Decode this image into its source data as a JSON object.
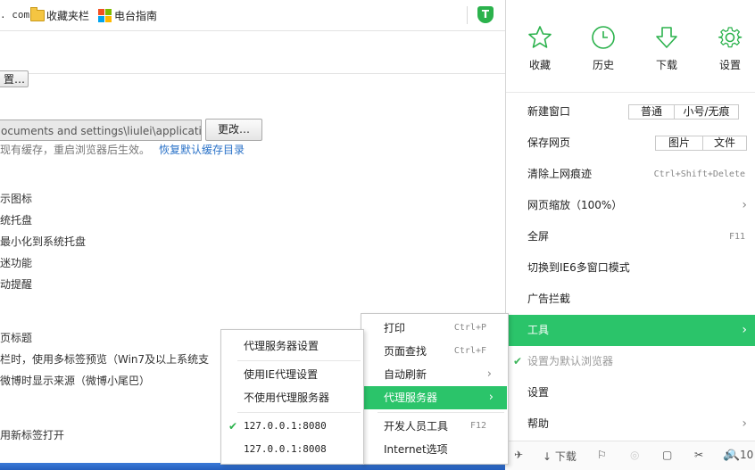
{
  "bookmarks": {
    "address_fragment": ". com",
    "folder_label": "收藏夹栏",
    "guide_label": "电台指南"
  },
  "settings": {
    "button_partial": "置…",
    "cache_path": "ocuments and settings\\liulei\\application",
    "change_button": "更改…",
    "hint_text": "现有缓存，重启浏览器后生效。",
    "restore_link": "恢复默认缓存目录",
    "options": [
      "示图标",
      "统托盘",
      "最小化到系统托盘",
      "迷功能",
      "动提醒",
      "页标题",
      "栏时，使用多标签预览（Win7及以上系统支",
      "微博时显示来源（微博小尾巴）",
      "用新标签打开"
    ]
  },
  "main_menu": {
    "quick": [
      {
        "label": "收藏",
        "icon": "star-icon"
      },
      {
        "label": "历史",
        "icon": "clock-icon"
      },
      {
        "label": "下载",
        "icon": "download-icon"
      },
      {
        "label": "设置",
        "icon": "gear-icon"
      }
    ],
    "new_window": {
      "label": "新建窗口",
      "opt1": "普通",
      "opt2": "小号/无痕"
    },
    "save_page": {
      "label": "保存网页",
      "opt1": "图片",
      "opt2": "文件"
    },
    "clear_traces": {
      "label": "清除上网痕迹",
      "shortcut": "Ctrl+Shift+Delete"
    },
    "zoom": {
      "label": "网页缩放（100%）"
    },
    "fullscreen": {
      "label": "全屏",
      "shortcut": "F11"
    },
    "ie6": {
      "label": "切换到IE6多窗口模式"
    },
    "adblock": {
      "label": "广告拦截"
    },
    "tools": {
      "label": "工具"
    },
    "default_browser": {
      "label": "设置为默认浏览器"
    },
    "settings": {
      "label": "设置"
    },
    "help": {
      "label": "帮助"
    }
  },
  "status_bar": {
    "download_label": "下载",
    "zoom_fragment": "10"
  },
  "tools_menu": {
    "print": {
      "label": "打印",
      "shortcut": "Ctrl+P"
    },
    "find": {
      "label": "页面查找",
      "shortcut": "Ctrl+F"
    },
    "auto_refresh": {
      "label": "自动刷新"
    },
    "proxy": {
      "label": "代理服务器"
    },
    "devtools": {
      "label": "开发人员工具",
      "shortcut": "F12"
    },
    "internet_options": {
      "label": "Internet选项"
    }
  },
  "proxy_menu": {
    "settings": "代理服务器设置",
    "use_ie": "使用IE代理设置",
    "no_proxy": "不使用代理服务器",
    "proxy1": "127.0.0.1:8080",
    "proxy2": "127.0.0.1:8008"
  },
  "colors": {
    "accent": "#2bc46a",
    "link": "#2a72c8"
  }
}
